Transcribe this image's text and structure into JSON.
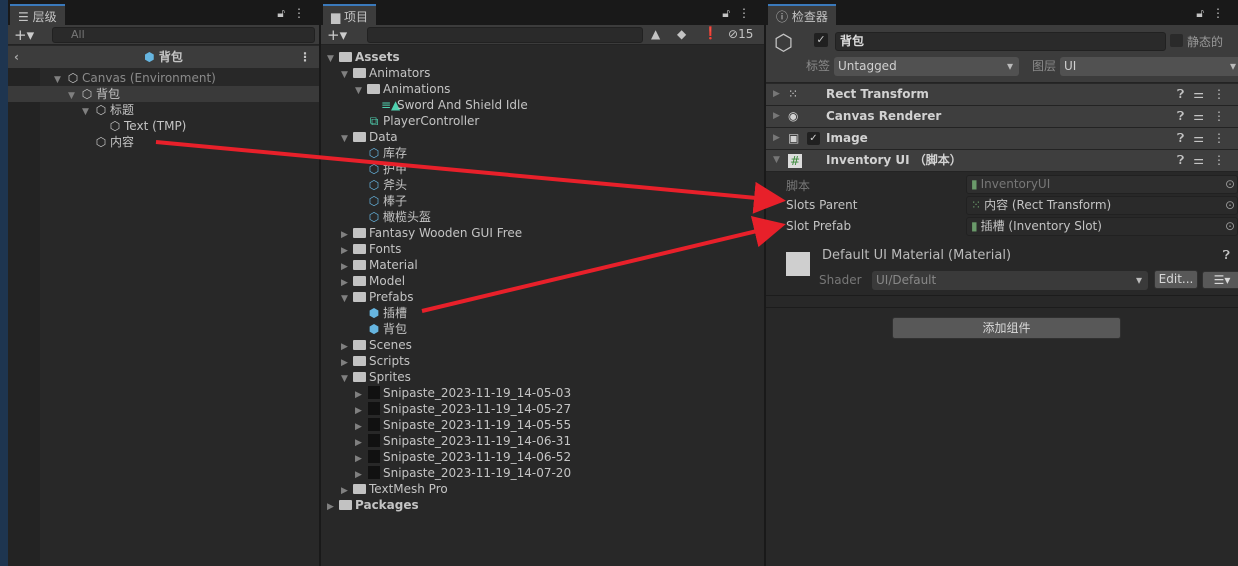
{
  "hierarchy": {
    "tab_label": "层级",
    "search_placeholder": "All",
    "prefab_title": "背包",
    "rows": [
      {
        "label": "Canvas (Environment)",
        "depth": 0,
        "expanded": true,
        "dim": true
      },
      {
        "label": "背包",
        "depth": 1,
        "expanded": true,
        "selected": true
      },
      {
        "label": "标题",
        "depth": 2,
        "expanded": true
      },
      {
        "label": "Text (TMP)",
        "depth": 3
      },
      {
        "label": "内容",
        "depth": 2
      }
    ]
  },
  "project": {
    "tab_label": "项目",
    "search_value": "",
    "hidden_count": "15",
    "rows": [
      {
        "label": "Assets",
        "depth": 0,
        "type": "folder",
        "expanded": true,
        "bold": true
      },
      {
        "label": "Animators",
        "depth": 1,
        "type": "folder",
        "expanded": true
      },
      {
        "label": "Animations",
        "depth": 2,
        "type": "folder",
        "expanded": true
      },
      {
        "label": "Sword And Shield Idle",
        "depth": 3,
        "type": "anim"
      },
      {
        "label": "PlayerController",
        "depth": 2,
        "type": "controller"
      },
      {
        "label": "Data",
        "depth": 1,
        "type": "folder",
        "expanded": true
      },
      {
        "label": "库存",
        "depth": 2,
        "type": "so"
      },
      {
        "label": "护甲",
        "depth": 2,
        "type": "so"
      },
      {
        "label": "斧头",
        "depth": 2,
        "type": "so"
      },
      {
        "label": "棒子",
        "depth": 2,
        "type": "so"
      },
      {
        "label": "橄榄头盔",
        "depth": 2,
        "type": "so"
      },
      {
        "label": "Fantasy Wooden GUI  Free",
        "depth": 1,
        "type": "folder"
      },
      {
        "label": "Fonts",
        "depth": 1,
        "type": "folder"
      },
      {
        "label": "Material",
        "depth": 1,
        "type": "folder"
      },
      {
        "label": "Model",
        "depth": 1,
        "type": "folder"
      },
      {
        "label": "Prefabs",
        "depth": 1,
        "type": "folder",
        "expanded": true
      },
      {
        "label": "插槽",
        "depth": 2,
        "type": "prefab"
      },
      {
        "label": "背包",
        "depth": 2,
        "type": "prefab"
      },
      {
        "label": "Scenes",
        "depth": 1,
        "type": "folder"
      },
      {
        "label": "Scripts",
        "depth": 1,
        "type": "folder"
      },
      {
        "label": "Sprites",
        "depth": 1,
        "type": "folder",
        "expanded": true
      },
      {
        "label": "Snipaste_2023-11-19_14-05-03",
        "depth": 2,
        "type": "sprite"
      },
      {
        "label": "Snipaste_2023-11-19_14-05-27",
        "depth": 2,
        "type": "sprite"
      },
      {
        "label": "Snipaste_2023-11-19_14-05-55",
        "depth": 2,
        "type": "sprite"
      },
      {
        "label": "Snipaste_2023-11-19_14-06-31",
        "depth": 2,
        "type": "sprite"
      },
      {
        "label": "Snipaste_2023-11-19_14-06-52",
        "depth": 2,
        "type": "sprite"
      },
      {
        "label": "Snipaste_2023-11-19_14-07-20",
        "depth": 2,
        "type": "sprite"
      },
      {
        "label": "TextMesh Pro",
        "depth": 1,
        "type": "folder"
      },
      {
        "label": "Packages",
        "depth": 0,
        "type": "folder",
        "bold": true
      }
    ]
  },
  "inspector": {
    "tab_label": "检查器",
    "object_name": "背包",
    "static_label": "静态的",
    "tag_label": "标签",
    "tag_value": "Untagged",
    "layer_label": "图层",
    "layer_value": "UI",
    "components": [
      {
        "name": "Rect Transform",
        "icon": "⁙"
      },
      {
        "name": "Canvas Renderer",
        "icon": "◉"
      },
      {
        "name": "Image",
        "icon": "▣"
      },
      {
        "name": "Inventory UI （脚本）",
        "icon": "#"
      }
    ],
    "fields": [
      {
        "label": "脚本",
        "value": "InventoryUI",
        "dim": true
      },
      {
        "label": "Slots Parent",
        "value": "内容 (Rect Transform)"
      },
      {
        "label": "Slot Prefab",
        "value": "插槽 (Inventory Slot)"
      }
    ],
    "material_name": "Default UI Material (Material)",
    "shader_label": "Shader",
    "shader_value": "UI/Default",
    "edit_button": "Edit...",
    "add_component": "添加组件"
  },
  "colors": {
    "annotation_arrow": "#e8202a",
    "prefab_icon": "#66b5e0",
    "selection": "#3a79bb"
  }
}
